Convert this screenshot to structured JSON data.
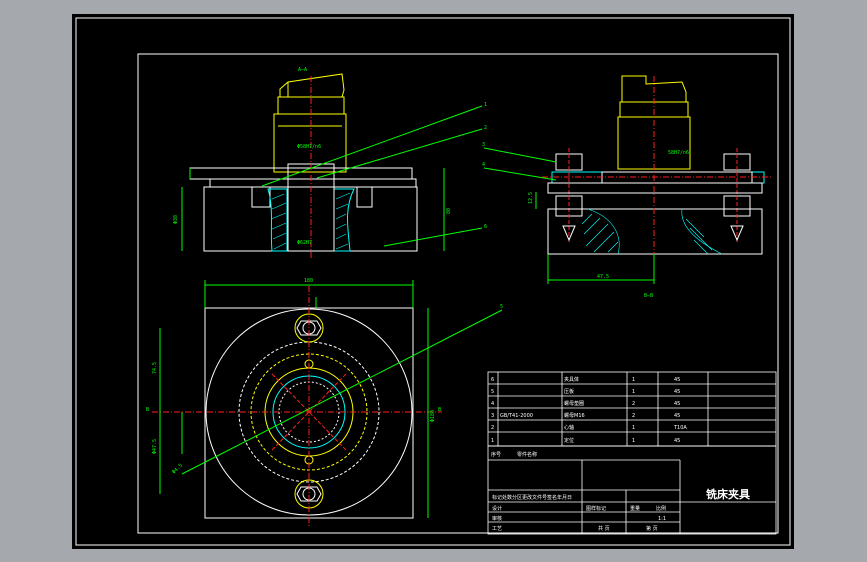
{
  "drawing": {
    "title": "铣床夹具",
    "view_label_section": "A—A",
    "view_label_b": "B—B",
    "dimensions": {
      "d1": "Φ58H7/n6",
      "d2": "Φ62H7",
      "d3": "Φ38",
      "d4": "80",
      "d5": "Φ180",
      "d6": "Φ4.5",
      "d7": "Φ47.5",
      "d8": "180",
      "d9": "58H7/n6",
      "d10": "Φ40",
      "d11": "12.5",
      "d12": "47.5",
      "d13": "74.5",
      "d14": "Φ4.5"
    },
    "leaders": [
      "1",
      "2",
      "3",
      "4",
      "5",
      "6"
    ],
    "parts_list": [
      {
        "no": "6",
        "code": "",
        "name": "夹具体",
        "qty": "1",
        "material": "45",
        "note": ""
      },
      {
        "no": "5",
        "code": "",
        "name": "压板",
        "qty": "1",
        "material": "45",
        "note": ""
      },
      {
        "no": "4",
        "code": "",
        "name": "螺母垫圈",
        "qty": "2",
        "material": "45",
        "note": ""
      },
      {
        "no": "3",
        "code": "GB/T41-2000",
        "name": "螺母M16",
        "qty": "2",
        "material": "45",
        "note": ""
      },
      {
        "no": "2",
        "code": "",
        "name": "心轴",
        "qty": "1",
        "material": "T10A",
        "note": ""
      },
      {
        "no": "1",
        "code": "",
        "name": "定位",
        "qty": "1",
        "material": "45",
        "note": ""
      }
    ],
    "title_block": {
      "header": [
        "序号",
        "零件名称",
        "数量",
        "材料",
        "备注"
      ],
      "sub_rows": [
        "标记处数分区更改文件号签名年月日",
        "设计",
        "审核",
        "工艺"
      ],
      "mid": [
        "图样标记",
        "重量",
        "比例"
      ],
      "scale": "1:1",
      "sheet": [
        "共 页",
        "第 页"
      ]
    }
  }
}
